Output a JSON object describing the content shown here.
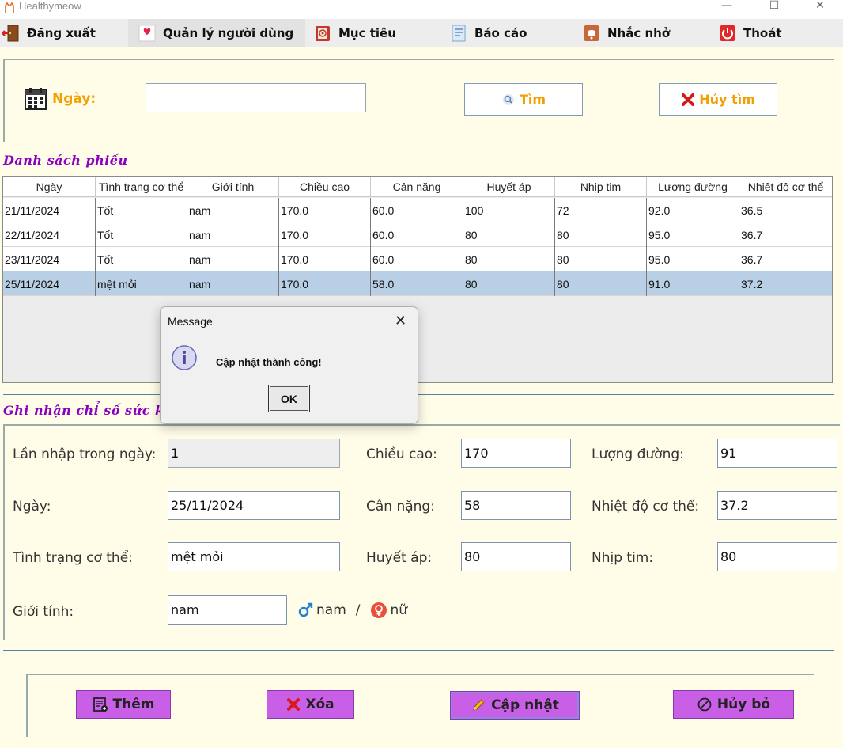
{
  "window": {
    "title": "Healthymeow",
    "minimize": "—",
    "maximize": "☐",
    "close": "✕"
  },
  "menu": [
    {
      "label": "Đăng xuất"
    },
    {
      "label": "Quản lý người dùng"
    },
    {
      "label": "Mục tiêu"
    },
    {
      "label": "Báo cáo"
    },
    {
      "label": "Nhắc nhở"
    },
    {
      "label": "Thoát"
    }
  ],
  "search": {
    "label": "Ngày:",
    "value": "",
    "find_label": "Tìm",
    "cancel_label": "Hủy tìm"
  },
  "list": {
    "title": "Danh sách phiếu",
    "columns": [
      "Ngày",
      "Tình trạng cơ thể",
      "Giới tính",
      "Chiều cao",
      "Cân nặng",
      "Huyết áp",
      "Nhịp tim",
      "Lượng đường",
      "Nhiệt độ cơ thể"
    ],
    "rows": [
      [
        "21/11/2024",
        "Tốt",
        "nam",
        "170.0",
        "60.0",
        "100",
        "72",
        "92.0",
        "36.5"
      ],
      [
        "22/11/2024",
        "Tốt",
        "nam",
        "170.0",
        "60.0",
        "80",
        "80",
        "95.0",
        "36.7"
      ],
      [
        "23/11/2024",
        "Tốt",
        "nam",
        "170.0",
        "60.0",
        "80",
        "80",
        "95.0",
        "36.7"
      ],
      [
        "25/11/2024",
        "mệt mỏi",
        "nam",
        "170.0",
        "58.0",
        "80",
        "80",
        "91.0",
        "37.2"
      ]
    ],
    "selected_row": 3
  },
  "form": {
    "title": "Ghi nhận chỉ số sức k",
    "lan_nhap_label": "Lần nhập trong ngày:",
    "lan_nhap_value": "1",
    "ngay_label": "Ngày:",
    "ngay_value": "25/11/2024",
    "tinh_trang_label": "Tình trạng cơ thể:",
    "tinh_trang_value": "mệt mỏi",
    "gioi_tinh_label": "Giới tính:",
    "gioi_tinh_value": "nam",
    "gender_male": "nam",
    "gender_sep": "/",
    "gender_female": "nữ",
    "chieu_cao_label": "Chiều cao:",
    "chieu_cao_value": "170",
    "can_nang_label": "Cân nặng:",
    "can_nang_value": "58",
    "huyet_ap_label": "Huyết áp:",
    "huyet_ap_value": "80",
    "luong_duong_label": "Lượng đường:",
    "luong_duong_value": "91",
    "nhiet_do_label": "Nhiệt độ cơ thể:",
    "nhiet_do_value": "37.2",
    "nhip_tim_label": "Nhịp tim:",
    "nhip_tim_value": "80"
  },
  "actions": {
    "add_label": "Thêm",
    "delete_label": "Xóa",
    "update_label": "Cập nhật",
    "cancel_label": "Hủy bỏ"
  },
  "dialog": {
    "title": "Message",
    "message": "Cập nhật thành công!",
    "ok_label": "OK"
  },
  "colors": {
    "accent_orange": "#f2a000",
    "section_purple": "#8a00c2",
    "button_purple": "#c95fe6",
    "selected_row": "#b8cfe5"
  }
}
